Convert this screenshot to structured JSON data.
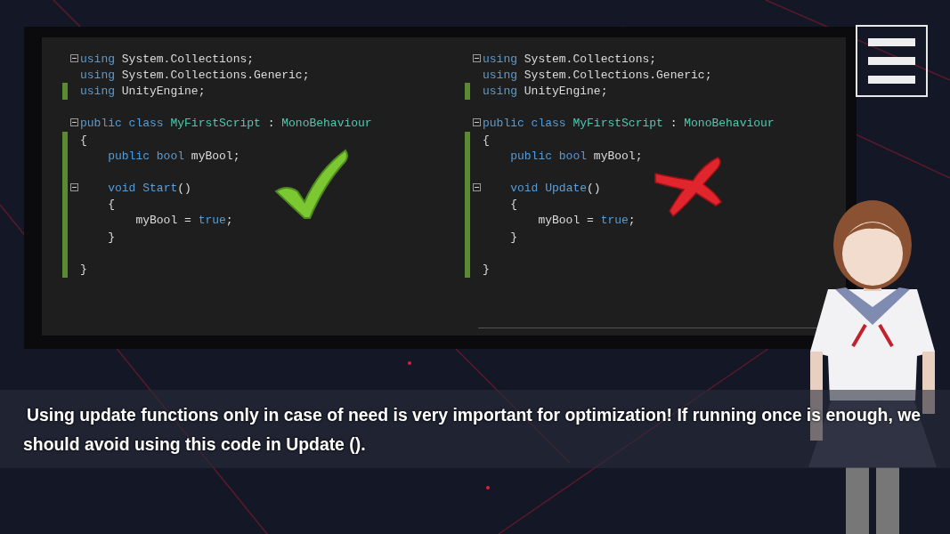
{
  "code_panels": [
    {
      "kind": "check",
      "lines": [
        {
          "kind": "code",
          "fold": true,
          "changed": false,
          "tokens": [
            {
              "text": "using",
              "kind": "keyword"
            },
            {
              "text": " System.Collections;",
              "kind": "plain"
            }
          ]
        },
        {
          "kind": "code",
          "fold": false,
          "changed": false,
          "tokens": [
            {
              "text": "using",
              "kind": "keyword"
            },
            {
              "text": " System.Collections.Generic;",
              "kind": "plain"
            }
          ]
        },
        {
          "kind": "code",
          "fold": false,
          "changed": true,
          "tokens": [
            {
              "text": "using",
              "kind": "keyword"
            },
            {
              "text": " UnityEngine;",
              "kind": "plain"
            }
          ]
        },
        {
          "kind": "blank"
        },
        {
          "kind": "code",
          "fold": true,
          "changed": false,
          "tokens": [
            {
              "text": "public class",
              "kind": "keyword"
            },
            {
              "text": " MyFirstScript",
              "kind": "type"
            },
            {
              "text": " : ",
              "kind": "plain"
            },
            {
              "text": "MonoBehaviour",
              "kind": "type"
            }
          ]
        },
        {
          "kind": "code",
          "fold": false,
          "changed": true,
          "tokens": [
            {
              "text": "{",
              "kind": "brace-open"
            }
          ]
        },
        {
          "kind": "code",
          "fold": false,
          "changed": true,
          "tokens": [
            {
              "text": "public bool",
              "kind": "keyword"
            },
            {
              "text": " myBool;",
              "kind": "plain"
            }
          ]
        },
        {
          "kind": "blank",
          "changed": true
        },
        {
          "kind": "code",
          "fold": true,
          "changed": true,
          "tokens": [
            {
              "text": "void",
              "kind": "keyword"
            },
            {
              "text": " Start",
              "kind": "method"
            },
            {
              "text": "()",
              "kind": "plain"
            }
          ]
        },
        {
          "kind": "code",
          "fold": false,
          "changed": true,
          "tokens": [
            {
              "text": "{",
              "kind": "brace-open"
            }
          ]
        },
        {
          "kind": "code",
          "fold": false,
          "changed": true,
          "tokens": [
            {
              "text": "myBool = ",
              "kind": "plain"
            },
            {
              "text": "true",
              "kind": "keyword"
            },
            {
              "text": ";",
              "kind": "plain"
            }
          ]
        },
        {
          "kind": "code",
          "fold": false,
          "changed": true,
          "tokens": [
            {
              "text": "}",
              "kind": "brace-close"
            }
          ]
        },
        {
          "kind": "blank",
          "changed": true
        },
        {
          "kind": "code",
          "fold": false,
          "changed": true,
          "tokens": [
            {
              "text": "}",
              "kind": "brace-close"
            }
          ]
        }
      ]
    },
    {
      "kind": "cross",
      "lines": [
        {
          "kind": "code",
          "fold": true,
          "changed": false,
          "tokens": [
            {
              "text": "using",
              "kind": "keyword"
            },
            {
              "text": " System.Collections;",
              "kind": "plain"
            }
          ]
        },
        {
          "kind": "code",
          "fold": false,
          "changed": false,
          "tokens": [
            {
              "text": "using",
              "kind": "keyword"
            },
            {
              "text": " System.Collections.Generic;",
              "kind": "plain"
            }
          ]
        },
        {
          "kind": "code",
          "fold": false,
          "changed": true,
          "tokens": [
            {
              "text": "using",
              "kind": "keyword"
            },
            {
              "text": " UnityEngine;",
              "kind": "plain"
            }
          ]
        },
        {
          "kind": "blank"
        },
        {
          "kind": "code",
          "fold": true,
          "changed": false,
          "tokens": [
            {
              "text": "public class",
              "kind": "keyword"
            },
            {
              "text": " MyFirstScript",
              "kind": "type"
            },
            {
              "text": " : ",
              "kind": "plain"
            },
            {
              "text": "MonoBehaviour",
              "kind": "type"
            }
          ]
        },
        {
          "kind": "code",
          "fold": false,
          "changed": true,
          "tokens": [
            {
              "text": "{",
              "kind": "brace-open"
            }
          ]
        },
        {
          "kind": "code",
          "fold": false,
          "changed": true,
          "tokens": [
            {
              "text": "public bool",
              "kind": "keyword"
            },
            {
              "text": " myBool;",
              "kind": "plain"
            }
          ]
        },
        {
          "kind": "blank",
          "changed": true
        },
        {
          "kind": "code",
          "fold": true,
          "changed": true,
          "tokens": [
            {
              "text": "void",
              "kind": "keyword"
            },
            {
              "text": " Update",
              "kind": "method"
            },
            {
              "text": "()",
              "kind": "plain"
            }
          ]
        },
        {
          "kind": "code",
          "fold": false,
          "changed": true,
          "tokens": [
            {
              "text": "{",
              "kind": "brace-open"
            }
          ]
        },
        {
          "kind": "code",
          "fold": false,
          "changed": true,
          "tokens": [
            {
              "text": "myBool = ",
              "kind": "plain"
            },
            {
              "text": "true",
              "kind": "keyword"
            },
            {
              "text": ";",
              "kind": "plain"
            }
          ]
        },
        {
          "kind": "code",
          "fold": false,
          "changed": true,
          "tokens": [
            {
              "text": "}",
              "kind": "brace-close"
            }
          ]
        },
        {
          "kind": "blank",
          "changed": true
        },
        {
          "kind": "code",
          "fold": false,
          "changed": true,
          "tokens": [
            {
              "text": "}",
              "kind": "brace-close"
            }
          ]
        }
      ]
    }
  ],
  "dialogue": {
    "text": "Using update functions only in case of need is very important for optimization! If running once is enough, we should avoid using this code in Update ()."
  }
}
